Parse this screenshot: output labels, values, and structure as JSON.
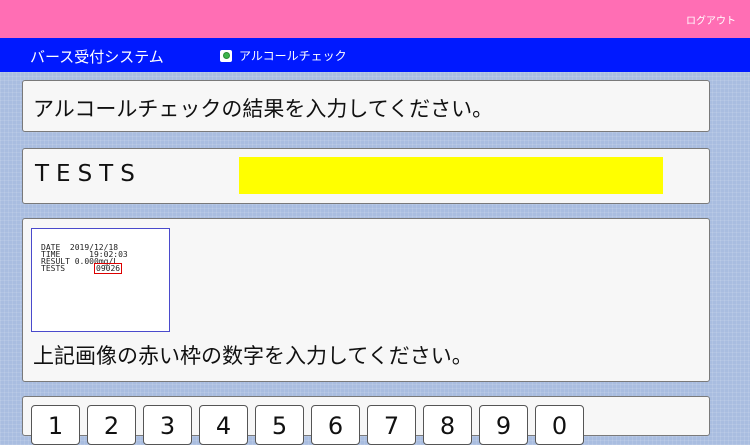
{
  "header": {
    "logout_label": "ログアウト"
  },
  "nav": {
    "system_title": "バース受付システム",
    "breadcrumb_label": "アルコールチェック",
    "breadcrumb_icon": "gear-icon"
  },
  "instruction": {
    "text": "アルコールチェックの結果を入力してください。"
  },
  "tests_field": {
    "label": "TESTS",
    "value": ""
  },
  "receipt": {
    "date_label": "DATE",
    "date_value": "2019/12/18",
    "time_label": "TIME",
    "time_value": "19:02:03",
    "result_label": "RESULT",
    "result_value": "0.000mg/L",
    "tests_label": "TESTS",
    "tests_value": "09026"
  },
  "image_instruction": {
    "text": "上記画像の赤い枠の数字を入力してください。"
  },
  "keypad": {
    "keys": [
      "1",
      "2",
      "3",
      "4",
      "5",
      "6",
      "7",
      "8",
      "9",
      "0"
    ]
  },
  "colors": {
    "header": "#ff6eb4",
    "nav": "#0019ff",
    "field_highlight": "#ffff00",
    "receipt_highlight": "#dd0000"
  }
}
